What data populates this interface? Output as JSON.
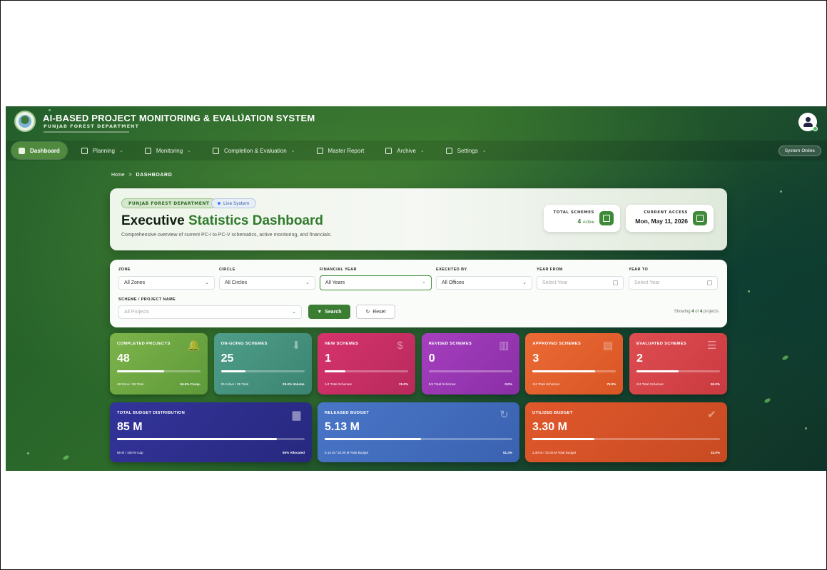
{
  "header": {
    "title": "AI-BASED PROJECT MONITORING & EVALUATION SYSTEM",
    "subtitle": "PUNJAB FOREST DEPARTMENT"
  },
  "nav": {
    "items": [
      {
        "label": "Dashboard",
        "active": true,
        "dropdown": false
      },
      {
        "label": "Planning",
        "active": false,
        "dropdown": true
      },
      {
        "label": "Monitoring",
        "active": false,
        "dropdown": true
      },
      {
        "label": "Completion & Evaluation",
        "active": false,
        "dropdown": true
      },
      {
        "label": "Master Report",
        "active": false,
        "dropdown": false
      },
      {
        "label": "Archive",
        "active": false,
        "dropdown": true
      },
      {
        "label": "Settings",
        "active": false,
        "dropdown": true
      }
    ],
    "status": "System Online"
  },
  "breadcrumb": {
    "home": "Home",
    "separator": ">",
    "current": "DASHBOARD"
  },
  "hero": {
    "dept_badge": "PUNJAB FOREST DEPARTMENT",
    "live_badge": "Live System",
    "title_a": "Executive ",
    "title_b": "Statistics Dashboard",
    "description": "Comprehensive overview of current PC-I to PC-V schematics, active monitoring, and financials.",
    "total_schemes_label": "TOTAL SCHEMES",
    "total_schemes_value": "4",
    "total_schemes_suffix": "Active",
    "access_label": "CURRENT ACCESS",
    "access_value": "Mon, May 11, 2026"
  },
  "filters": {
    "zone_label": "ZONE",
    "zone_value": "All Zones",
    "circle_label": "CIRCLE",
    "circle_value": "All Circles",
    "fy_label": "FINANCIAL YEAR",
    "fy_value": "All Years",
    "executed_label": "EXECUTED BY",
    "executed_value": "All Offices",
    "year_from_label": "YEAR FROM",
    "year_from_placeholder": "Select Year",
    "year_to_label": "YEAR TO",
    "year_to_placeholder": "Select Year",
    "scheme_label": "SCHEME / PROJECT NAME",
    "scheme_placeholder": "All Projects",
    "search_label": "Search",
    "reset_label": "Reset",
    "showing_pre": "Showing ",
    "showing_count": "4",
    "showing_mid": " of ",
    "showing_total": "4",
    "showing_post": " projects"
  },
  "cards": [
    {
      "label": "COMPLETED PROJECTS",
      "value": "48",
      "progress": 56.5,
      "foot": "48 Done / 85 Total",
      "pct": "56.5% Comp.",
      "icon": "bell-icon",
      "glyph": "🔔",
      "color_a": "#7db34a",
      "color_b": "#5e9a3a"
    },
    {
      "label": "ON-GOING SCHEMES",
      "value": "25",
      "progress": 29.4,
      "foot": "25 Active / 85 Total",
      "pct": "29.4% Volume",
      "icon": "download-icon",
      "glyph": "⬇",
      "color_a": "#4f9e8a",
      "color_b": "#3b8472"
    },
    {
      "label": "NEW SCHEMES",
      "value": "1",
      "progress": 25.0,
      "foot": "1/4 Total Schemes",
      "pct": "25.0%",
      "icon": "dollar-icon",
      "glyph": "$",
      "color_a": "#d6336c",
      "color_b": "#b82a5c"
    },
    {
      "label": "REVISED SCHEMES",
      "value": "0",
      "progress": 0,
      "foot": "0/4 Total Schemes",
      "pct": "0.0%",
      "icon": "bar-chart-icon",
      "glyph": "▥",
      "color_a": "#a63fbf",
      "color_b": "#8a2fa6"
    },
    {
      "label": "APPROVED SCHEMES",
      "value": "3",
      "progress": 75.0,
      "foot": "3/4 Total Schemes",
      "pct": "75.0%",
      "icon": "clipboard-icon",
      "glyph": "▤",
      "color_a": "#ec6a35",
      "color_b": "#d85625"
    },
    {
      "label": "EVALUATED SCHEMES",
      "value": "2",
      "progress": 50.0,
      "foot": "2/4 Total Schemes",
      "pct": "50.0%",
      "icon": "list-icon",
      "glyph": "☰",
      "color_a": "#de4d50",
      "color_b": "#c93a40"
    }
  ],
  "budget_cards": [
    {
      "label": "TOTAL BUDGET DISTRIBUTION",
      "value": "85 M",
      "progress": 85,
      "foot": "85 M / 100 M Cap",
      "pct": "85% Allocated",
      "icon": "folder-icon",
      "glyph": "▆",
      "color_a": "#33349a",
      "color_b": "#27287e"
    },
    {
      "label": "RELEASED BUDGET",
      "value": "5.13 M",
      "progress": 51.3,
      "foot": "5.13 M / 10.00 M Total Budget",
      "pct": "51.3%",
      "icon": "history-icon",
      "glyph": "↻",
      "color_a": "#4a76c8",
      "color_b": "#3a62b0"
    },
    {
      "label": "UTILIZED BUDGET",
      "value": "3.30 M",
      "progress": 33.0,
      "foot": "3.30 M / 10.00 M Total Budget",
      "pct": "33.0%",
      "icon": "check-circle-icon",
      "glyph": "✔",
      "color_a": "#e0582c",
      "color_b": "#c84a22"
    }
  ]
}
